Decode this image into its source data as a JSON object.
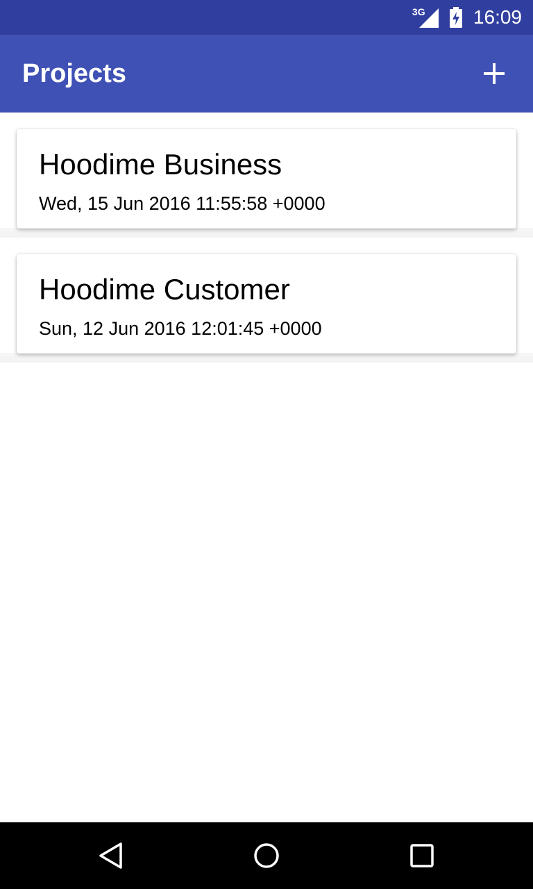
{
  "status_bar": {
    "network_type": "3G",
    "time": "16:09",
    "icons": [
      "signal-icon",
      "battery-icon"
    ]
  },
  "app_bar": {
    "title": "Projects",
    "add_icon": "plus-icon"
  },
  "projects": [
    {
      "name": "Hoodime Business",
      "date": "Wed, 15 Jun 2016 11:55:58 +0000"
    },
    {
      "name": "Hoodime Customer",
      "date": "Sun, 12 Jun 2016 12:01:45 +0000"
    }
  ],
  "nav_bar": {
    "icons": [
      "back-icon",
      "home-icon",
      "recent-apps-icon"
    ]
  },
  "colors": {
    "status_bar": "#303f9f",
    "app_bar": "#3f51b5",
    "nav_bar": "#000000",
    "background": "#ffffff"
  }
}
